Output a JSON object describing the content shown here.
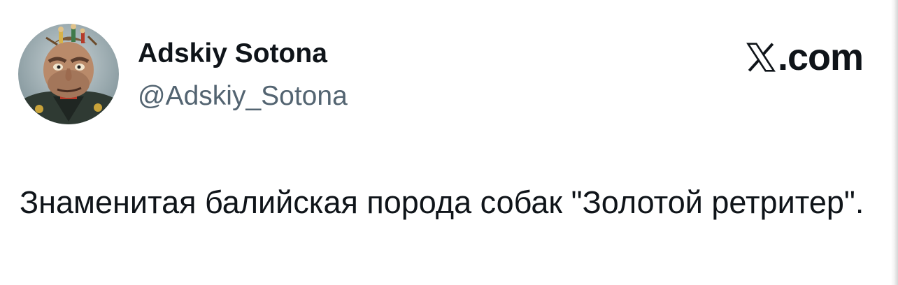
{
  "tweet": {
    "author": {
      "display_name": "Adskiy Sotona",
      "handle": "@Adskiy_Sotona",
      "avatar_icon": "cartoon-general-avatar"
    },
    "brand": {
      "icon": "x-logo-icon",
      "domain_suffix": ".com"
    },
    "text": "Знаменитая балийская порода собак \"Золотой ретритер\"."
  },
  "colors": {
    "text_primary": "#0f1419",
    "text_secondary": "#536471",
    "background": "#ffffff"
  }
}
